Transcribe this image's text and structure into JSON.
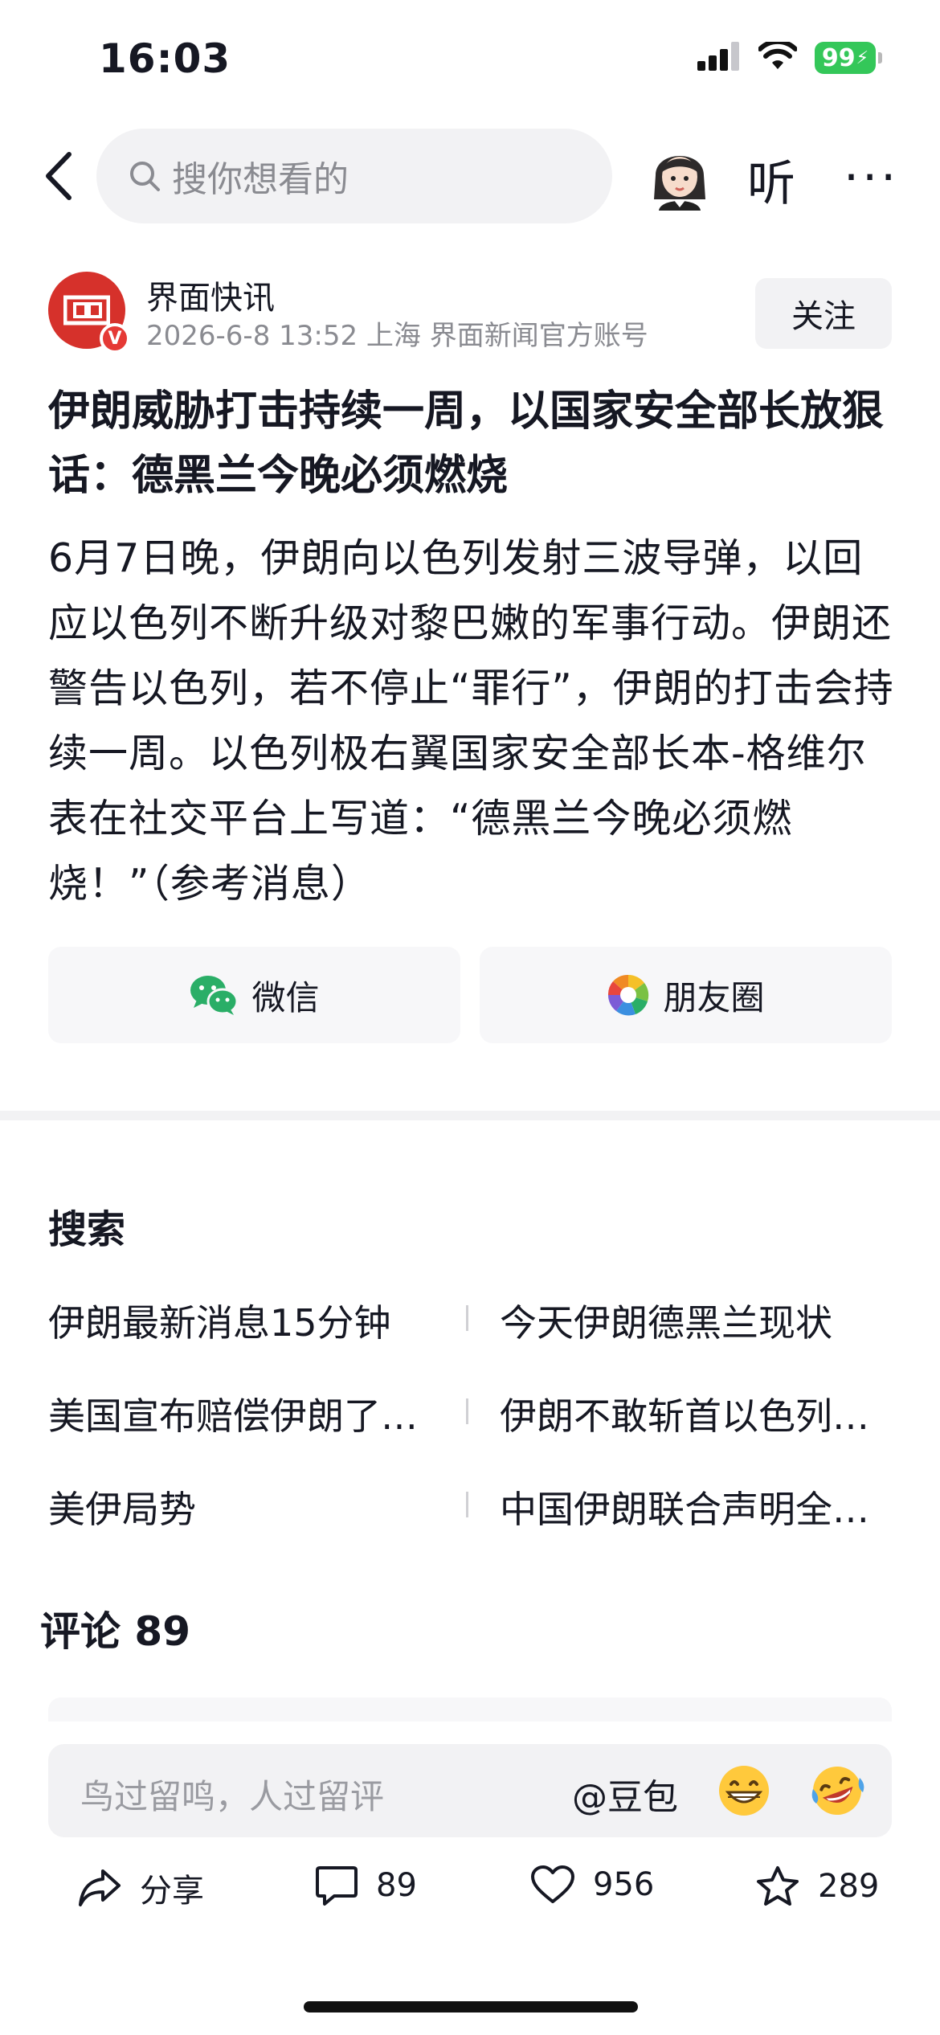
{
  "status_bar": {
    "time": "16:03",
    "battery_label": "99",
    "icons": [
      "signal-icon",
      "wifi-icon",
      "battery-charging-icon"
    ]
  },
  "header": {
    "search_placeholder": "搜你想看的",
    "listen_label": "听",
    "more_label": "···"
  },
  "author": {
    "name": "界面快讯",
    "meta": "2026-6-8  13:52  上海  界面新闻官方账号",
    "follow_label": "关注",
    "verified_label": "V"
  },
  "article": {
    "title": "伊朗威胁打击持续一周，以国家安全部长放狠话：德黑兰今晚必须燃烧",
    "body": "6月7日晚，伊朗向以色列发射三波导弹，以回应以色列不断升级对黎巴嫩的军事行动。伊朗还警告以色列，若不停止“罪行”，伊朗的打击会持续一周。以色列极右翼国家安全部长本-格维尔表在社交平台上写道：“德黑兰今晚必须燃烧！”（参考消息）"
  },
  "share": {
    "wechat_label": "微信",
    "moments_label": "朋友圈"
  },
  "search_section": {
    "title": "搜索",
    "suggestions": [
      [
        "伊朗最新消息15分钟",
        "今天伊朗德黑兰现状"
      ],
      [
        "美国宣布赔偿伊朗了…",
        "伊朗不敢斩首以色列…"
      ],
      [
        "美伊局势",
        "中国伊朗联合声明全…"
      ]
    ]
  },
  "comments": {
    "title": "评论 89"
  },
  "comment_input": {
    "placeholder": "鸟过留鸣，人过留评",
    "mention_label": "@豆包"
  },
  "actions": {
    "share_label": "分享",
    "comment_count": "89",
    "like_count": "956",
    "favorite_count": "289"
  },
  "colors": {
    "accent_red": "#d6312b",
    "battery_green": "#34c759",
    "wechat_green": "#2aae67"
  }
}
